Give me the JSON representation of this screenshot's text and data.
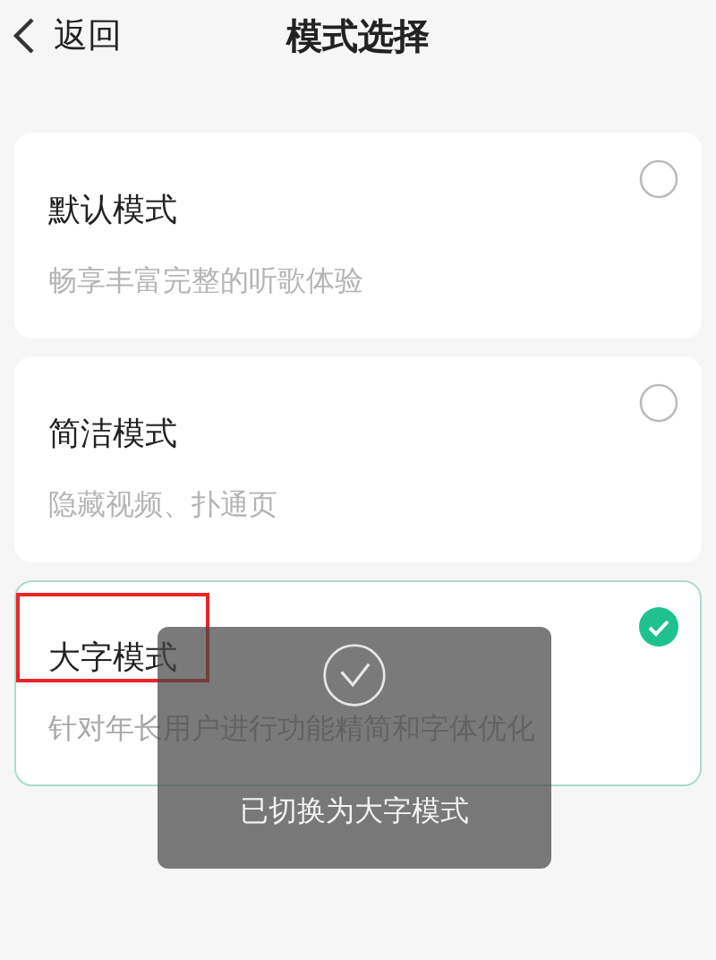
{
  "header": {
    "back_label": "返回",
    "title": "模式选择"
  },
  "modes": [
    {
      "name": "默认模式",
      "description": "畅享丰富完整的听歌体验",
      "selected": false,
      "highlighted": false
    },
    {
      "name": "简洁模式",
      "description": "隐藏视频、扑通页",
      "selected": false,
      "highlighted": false
    },
    {
      "name": "大字模式",
      "description": "针对年长用户进行功能精简和字体优化",
      "selected": true,
      "highlighted": true
    }
  ],
  "toast": {
    "message": "已切换为大字模式"
  }
}
